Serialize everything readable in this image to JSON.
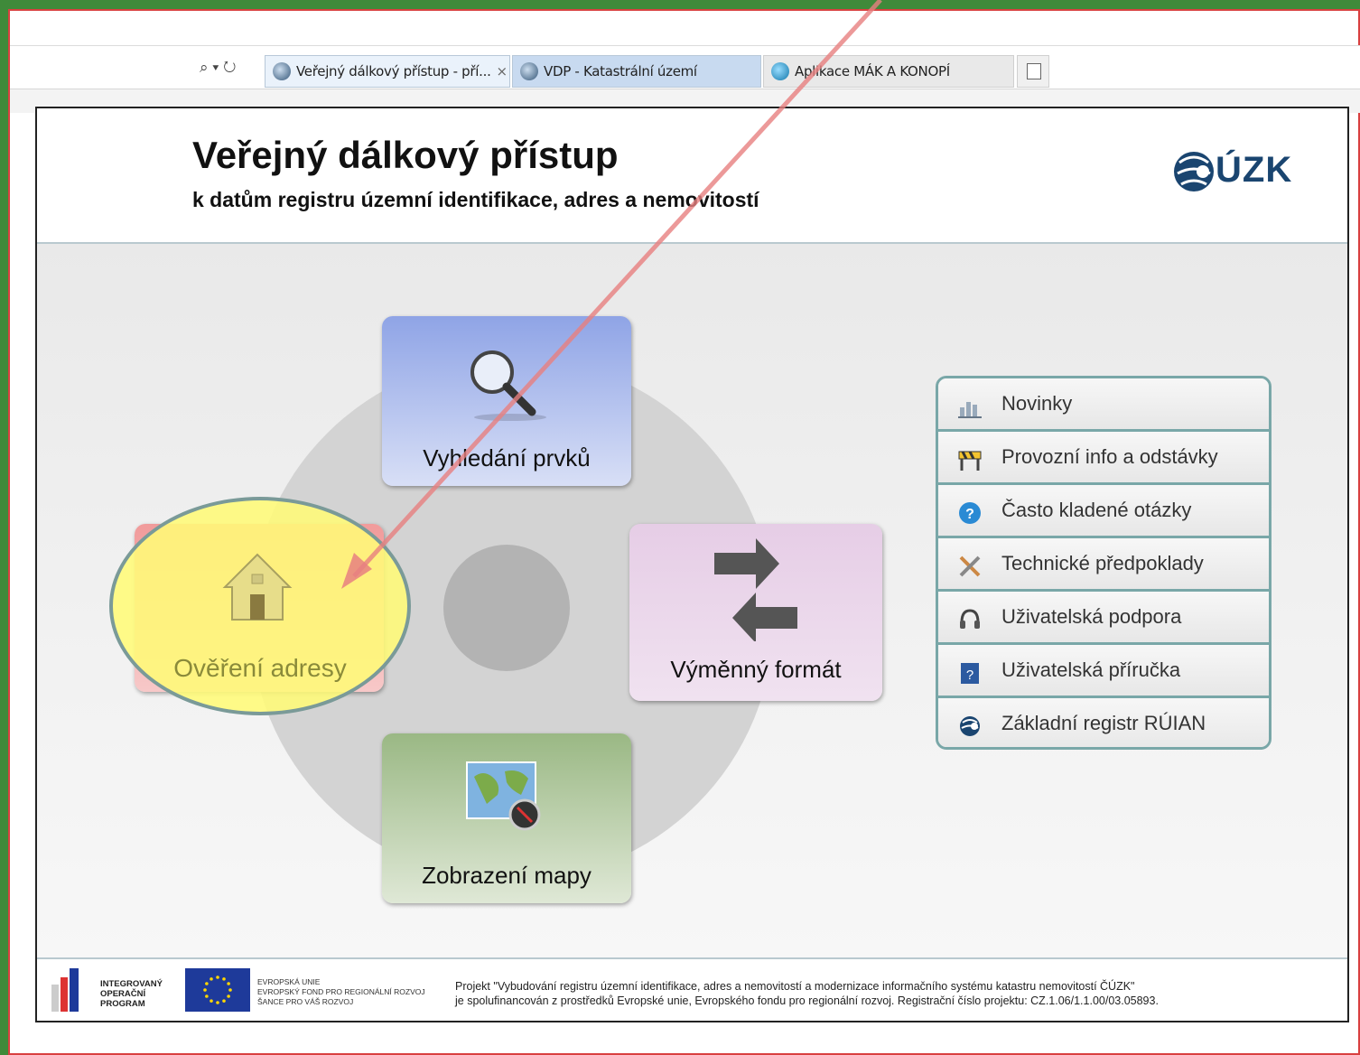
{
  "browser": {
    "tabs": [
      {
        "label": "Veřejný dálkový přístup - pří...",
        "close": "×"
      },
      {
        "label": "VDP - Katastrální území"
      },
      {
        "label": "Aplikace MÁK A KONOPÍ"
      }
    ],
    "address_tools": "⌕ ▾ ↻"
  },
  "header": {
    "title": "Veřejný dálkový přístup",
    "subtitle": "k datům registru územní identifikace, adres a nemovitostí",
    "logo_text": "ÚZK"
  },
  "tiles": {
    "search": "Vyhledání prvků",
    "address": "Ověření adresy",
    "exchange": "Výměnný formát",
    "map": "Zobrazení mapy"
  },
  "menu": {
    "items": [
      {
        "label": "Novinky",
        "icon": "news-icon"
      },
      {
        "label": "Provozní info a odstávky",
        "icon": "barrier-icon"
      },
      {
        "label": "Často kladené otázky",
        "icon": "help-icon"
      },
      {
        "label": "Technické předpoklady",
        "icon": "tools-icon"
      },
      {
        "label": "Uživatelská podpora",
        "icon": "headset-icon"
      },
      {
        "label": "Uživatelská příručka",
        "icon": "manual-icon"
      },
      {
        "label": "Základní registr RÚIAN",
        "icon": "ruian-icon"
      }
    ]
  },
  "footer": {
    "iop": [
      "INTEGROVANÝ",
      "OPERAČNÍ",
      "PROGRAM"
    ],
    "eu": [
      "EVROPSKÁ UNIE",
      "EVROPSKÝ FOND PRO REGIONÁLNÍ ROZVOJ",
      "ŠANCE PRO VÁŠ ROZVOJ"
    ],
    "text_line1": "Projekt \"Vybudování registru územní identifikace, adres a nemovitostí a modernizace informačního systému katastru nemovitostí ČÚZK\"",
    "text_line2": "je spolufinancován z prostředků Evropské unie, Evropského fondu pro regionální rozvoj. Registrační číslo projektu: CZ.1.06/1.1.00/03.05893."
  },
  "colors": {
    "arrow": "#e88080",
    "highlight": "#fff878",
    "menu_border": "#79a7a8"
  }
}
